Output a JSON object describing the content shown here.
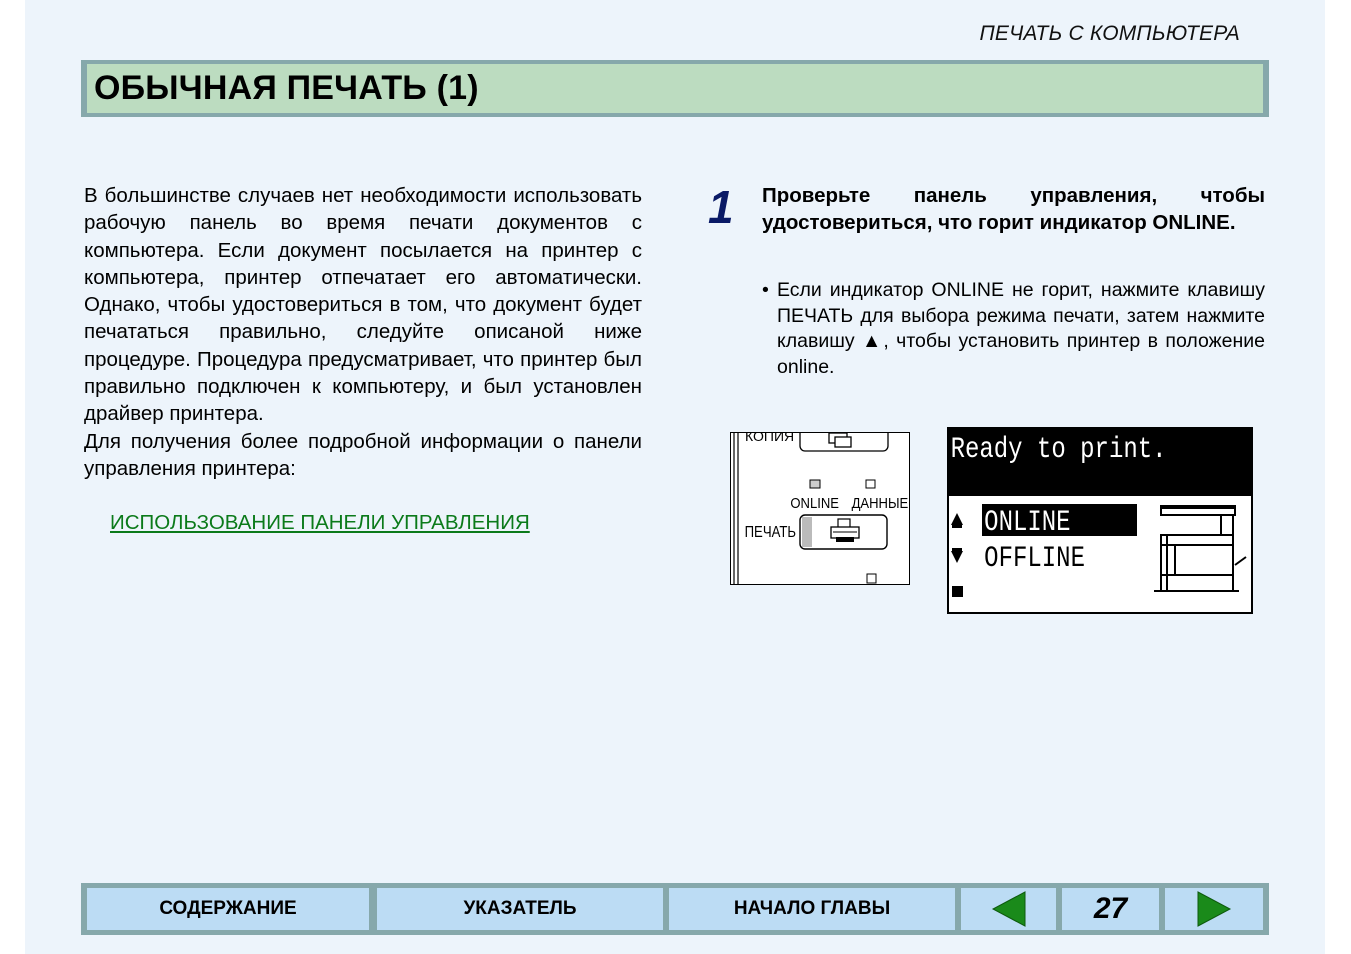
{
  "running_head": "ПЕЧАТЬ С КОМПЬЮТЕРА",
  "title": "ОБЫЧНАЯ ПЕЧАТЬ (1)",
  "intro": {
    "paragraph1": "В большинстве случаев нет необходимости использовать рабочую панель во время печати документов с компьютера. Если документ посылается на принтер с компьютера, принтер отпечатает его автоматически. Однако, чтобы удостовериться в том, что документ будет печататься правильно, следуйте описаной ниже процедуре. Процедура предусматривает, что принтер был правильно подключен к компьютеру, и был установлен драйвер принтера.",
    "paragraph2": "Для получения более подробной информации о панели управления принтера:",
    "link": "ИСПОЛЬЗОВАНИЕ ПАНЕЛИ УПРАВЛЕНИЯ"
  },
  "step": {
    "number": "1",
    "heading": "Проверьте панель управления, чтобы удостовериться, что горит индикатор ONLINE.",
    "bullet_mark": "•",
    "bullet": "Если индикатор ONLINE не горит, нажмите клавишу ПЕЧАТЬ для выбора режима печати, затем нажмите клавишу ▲, чтобы установить принтер в положение online."
  },
  "panel": {
    "top_label": "КОПИЯ",
    "online_label": "ONLINE",
    "data_label": "ДАННЫЕ",
    "print_label": "ПЕЧАТЬ"
  },
  "lcd": {
    "status": "Ready to print.",
    "option_online": "ONLINE",
    "option_offline": "OFFLINE",
    "selected": "ONLINE"
  },
  "nav": {
    "contents": "СОДЕРЖАНИЕ",
    "index": "УКАЗАТЕЛЬ",
    "chapter_start": "НАЧАЛО ГЛАВЫ",
    "page_number": "27"
  },
  "colors": {
    "page_bg": "#edf4fb",
    "title_bg": "#bcdcc0",
    "frame": "#86a8ab",
    "link": "#0b7a1a",
    "nav_btn": "#bcdcf4",
    "arrow": "#1a8a1a",
    "step_number": "#0a1a66"
  }
}
